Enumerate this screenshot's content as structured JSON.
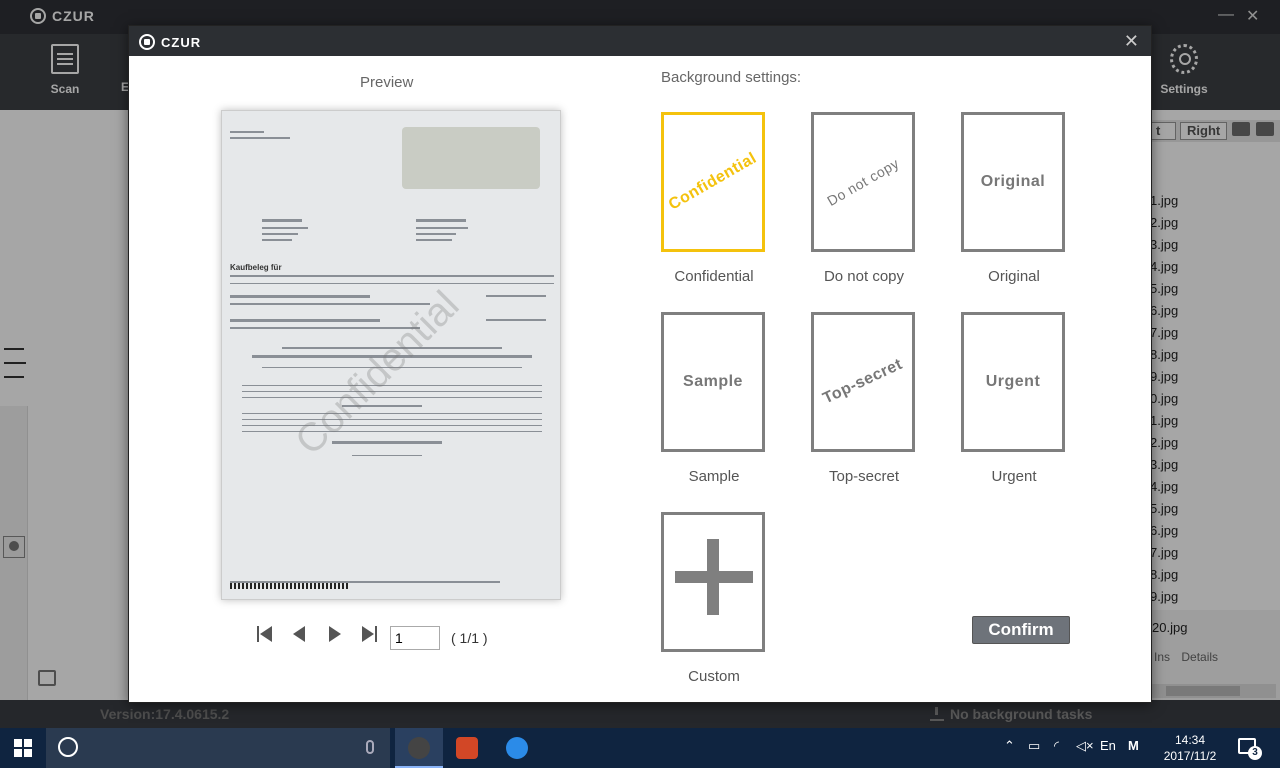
{
  "app": {
    "brand": "CZUR",
    "win_min": "—",
    "win_close": "✕",
    "toolbar": {
      "scan_label": "Scan",
      "settings_label": "Settings",
      "partial_label": "E"
    },
    "right_tabs": {
      "partial_left": "t",
      "right_label": "Right"
    },
    "files": [
      "1.jpg",
      "2.jpg",
      "3.jpg",
      "4.jpg",
      "5.jpg",
      "6.jpg",
      "7.jpg",
      "8.jpg",
      "9.jpg",
      "0.jpg",
      "1.jpg",
      "2.jpg",
      "3.jpg",
      "4.jpg",
      "5.jpg",
      "6.jpg",
      "7.jpg",
      "8.jpg",
      "9.jpg"
    ],
    "selected_file": "20.jpg",
    "ins_label": "Ins",
    "details_label": "Details",
    "version": "Version:17.4.0615.2",
    "bg_tasks": "No background tasks"
  },
  "dialog": {
    "brand": "CZUR",
    "close": "✕",
    "preview_label": "Preview",
    "page_input": "1",
    "page_count": "( 1/1 )",
    "paper": {
      "watermark": "Confidential",
      "heading": "Kaufbeleg für"
    },
    "bg_heading": "Background settings:",
    "tiles": [
      {
        "text": "Confidential",
        "label": "Confidential"
      },
      {
        "text": "Do not copy",
        "label": "Do not copy"
      },
      {
        "text": "Original",
        "label": "Original"
      },
      {
        "text": "Sample",
        "label": "Sample"
      },
      {
        "text": "Top-secret",
        "label": "Top-secret"
      },
      {
        "text": "Urgent",
        "label": "Urgent"
      },
      {
        "label": "Custom"
      }
    ],
    "confirm_label": "Confirm"
  },
  "taskbar": {
    "lang": "En",
    "ime": "M",
    "time": "14:34",
    "date": "2017/11/2",
    "notifications": "3"
  },
  "colors": {
    "selected_border": "#f4c20d",
    "tile_border": "#7f7f7f",
    "dialog_title": "#2c2f33",
    "confirm_bg": "#6e737a"
  }
}
